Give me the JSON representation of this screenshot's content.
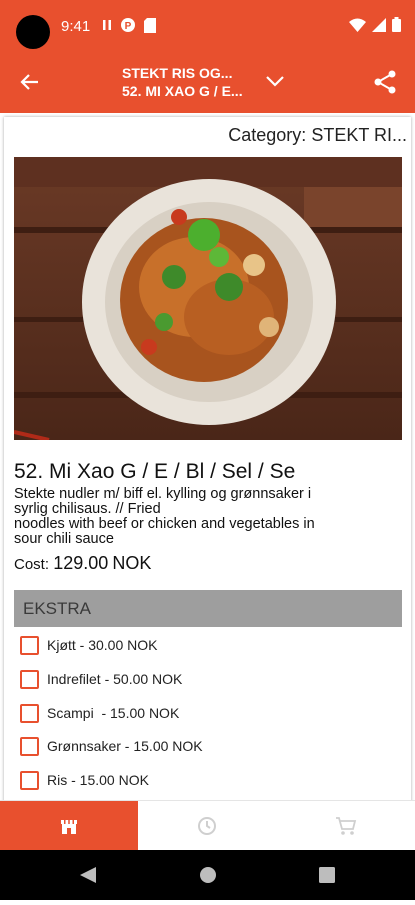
{
  "status_bar": {
    "time": "9:41"
  },
  "header": {
    "title": "STEKT RIS OG...",
    "subtitle": "52. MI XAO G / E..."
  },
  "category": {
    "label": "Category:",
    "value": "STEKT RI..."
  },
  "dish": {
    "name": "52. Mi Xao G / E / Bl / Sel / Se",
    "desc_line1": "Stekte nudler m/ biff el. kylling og grønnsaker i",
    "desc_line2": "syrlig chilisaus. // Fried",
    "desc_line3": "noodles with beef or chicken and vegetables in",
    "desc_line4": "sour chili sauce",
    "cost_label": "Cost:",
    "cost_value": "129.00",
    "currency": "NOK"
  },
  "extras": {
    "title": "EKSTRA",
    "items": [
      {
        "label": "Kjøtt - 30.00 NOK",
        "checked": false
      },
      {
        "label": "Indrefilet - 50.00 NOK",
        "checked": false
      },
      {
        "label": "Scampi  - 15.00 NOK",
        "checked": false
      },
      {
        "label": "Grønnsaker - 15.00 NOK",
        "checked": false
      },
      {
        "label": "Ris - 15.00 NOK",
        "checked": false
      }
    ]
  },
  "bottom_nav": {
    "tabs": [
      {
        "icon": "menu-store-icon",
        "active": true
      },
      {
        "icon": "history-clock-icon",
        "active": false
      },
      {
        "icon": "cart-icon",
        "active": false
      }
    ]
  },
  "colors": {
    "accent": "#e8502e",
    "section_bg": "#9e9e9e"
  }
}
